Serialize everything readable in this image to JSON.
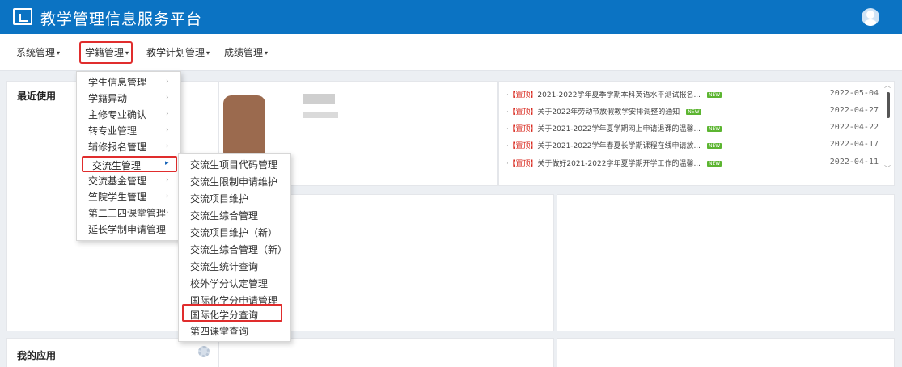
{
  "app": {
    "title": "教学管理信息服务平台"
  },
  "menubar": {
    "items": [
      {
        "label": "系统管理"
      },
      {
        "label": "学籍管理"
      },
      {
        "label": "教学计划管理"
      },
      {
        "label": "成绩管理"
      }
    ],
    "caret": "▾"
  },
  "panels": {
    "recent": {
      "title": "最近使用"
    },
    "apps": {
      "title": "我的应用"
    }
  },
  "news": [
    {
      "tag": "【置顶】",
      "text": "2021-2022学年夏季学期本科英语水平测试报名...",
      "badge": "NEW",
      "date": "2022-05-04"
    },
    {
      "tag": "【置顶】",
      "text": "关于2022年劳动节放假教学安排调整的通知",
      "badge": "NEW",
      "date": "2022-04-27"
    },
    {
      "tag": "【置顶】",
      "text": "关于2021-2022学年夏学期网上申请退课的温馨...",
      "badge": "NEW",
      "date": "2022-04-22"
    },
    {
      "tag": "【置顶】",
      "text": "关于2021-2022学年春夏长学期课程在线申请放...",
      "badge": "NEW",
      "date": "2022-04-17"
    },
    {
      "tag": "【置顶】",
      "text": "关于做好2021-2022学年夏学期开学工作的温馨...",
      "badge": "NEW",
      "date": "2022-04-11"
    }
  ],
  "news_bullet": "·",
  "scroll": {
    "up": "︿",
    "down": "﹀"
  },
  "dropdown1": {
    "items": [
      {
        "label": "学生信息管理",
        "arrow": "›"
      },
      {
        "label": "学籍异动",
        "arrow": "›"
      },
      {
        "label": "主修专业确认",
        "arrow": "›"
      },
      {
        "label": "转专业管理",
        "arrow": "›"
      },
      {
        "label": "辅修报名管理",
        "arrow": "›"
      },
      {
        "label": "交流生管理",
        "arrow": "▸"
      },
      {
        "label": "交流基金管理",
        "arrow": "›"
      },
      {
        "label": "竺院学生管理",
        "arrow": "›"
      },
      {
        "label": "第二三四课堂管理",
        "arrow": "›"
      },
      {
        "label": "延长学制申请管理",
        "arrow": ""
      }
    ]
  },
  "dropdown2": {
    "items": [
      {
        "label": "交流生项目代码管理"
      },
      {
        "label": "交流生限制申请维护"
      },
      {
        "label": "交流项目维护"
      },
      {
        "label": "交流生综合管理"
      },
      {
        "label": "交流项目维护（新）"
      },
      {
        "label": "交流生综合管理（新）"
      },
      {
        "label": "交流生统计查询"
      },
      {
        "label": "校外学分认定管理"
      },
      {
        "label": "国际化学分申请管理"
      },
      {
        "label": "国际化学分查询"
      },
      {
        "label": "第四课堂查询"
      }
    ]
  },
  "colors": {
    "header": "#0b73c3",
    "accent_red": "#e02d2d",
    "new_badge": "#5cb531",
    "tag_red": "#d8261b"
  },
  "icons": [
    "logo-icon",
    "user-avatar-icon",
    "gear-icon",
    "chevron-right-icon",
    "caret-down-icon"
  ]
}
